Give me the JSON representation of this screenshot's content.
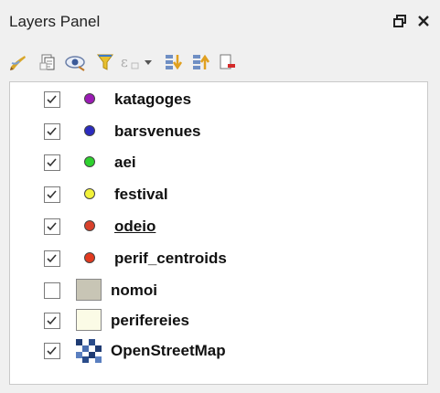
{
  "panel": {
    "title": "Layers Panel",
    "float_icon": "float-icon",
    "close_icon": "close-icon"
  },
  "toolbar": {
    "tools": [
      {
        "name": "style-manager-icon"
      },
      {
        "name": "add-group-icon"
      },
      {
        "name": "manage-visibility-icon"
      },
      {
        "name": "filter-legend-icon"
      },
      {
        "name": "filter-expression-icon"
      },
      {
        "name": "dropdown-arrow-icon"
      },
      {
        "name": "expand-all-icon"
      },
      {
        "name": "collapse-all-icon"
      },
      {
        "name": "remove-layer-icon"
      }
    ]
  },
  "layers": [
    {
      "name": "katagoges",
      "checked": true,
      "symbol": "dot",
      "color": "#9b1bb5",
      "underline": false
    },
    {
      "name": "barsvenues",
      "checked": true,
      "symbol": "dot",
      "color": "#2b2bbf",
      "underline": false
    },
    {
      "name": "aei",
      "checked": true,
      "symbol": "dot",
      "color": "#2ed12e",
      "underline": false
    },
    {
      "name": "festival",
      "checked": true,
      "symbol": "dot",
      "color": "#f2f23a",
      "underline": false
    },
    {
      "name": "odeio",
      "checked": true,
      "symbol": "dot",
      "color": "#d9412b",
      "underline": true
    },
    {
      "name": "perif_centroids",
      "checked": true,
      "symbol": "dot",
      "color": "#e23a1f",
      "underline": false
    },
    {
      "name": "nomoi",
      "checked": false,
      "symbol": "fill",
      "color": "#c8c5b5",
      "underline": false
    },
    {
      "name": "perifereies",
      "checked": true,
      "symbol": "fill",
      "color": "#fbfbe6",
      "underline": false
    },
    {
      "name": "OpenStreetMap",
      "checked": true,
      "symbol": "raster",
      "color": "#1f3b73",
      "underline": false
    }
  ]
}
